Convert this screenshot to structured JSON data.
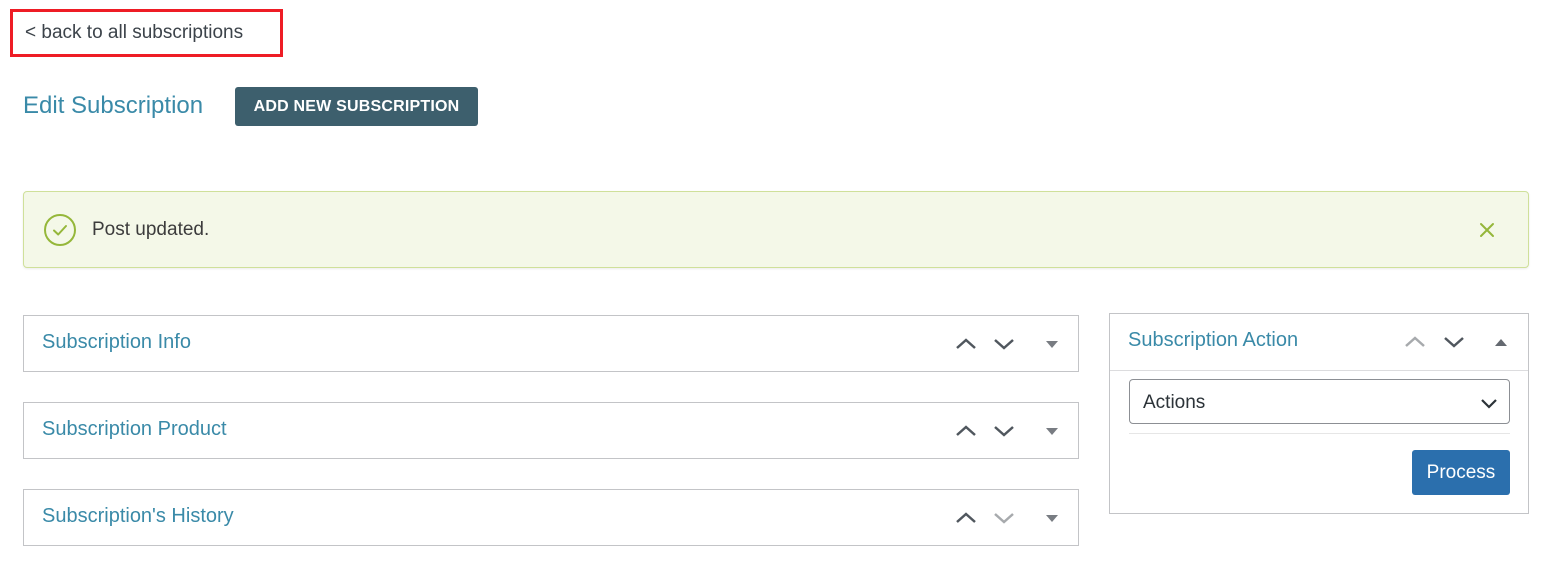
{
  "back_link": {
    "label": "< back to all subscriptions"
  },
  "header": {
    "title": "Edit Subscription",
    "add_new_label": "ADD NEW SUBSCRIPTION"
  },
  "notice": {
    "message": "Post updated.",
    "icon": "check-circle-icon",
    "dismiss_icon": "close-icon",
    "accent_color": "#95b73a"
  },
  "postboxes": [
    {
      "title": "Subscription Info"
    },
    {
      "title": "Subscription Product"
    },
    {
      "title": "Subscription's History"
    }
  ],
  "action_box": {
    "title": "Subscription Action",
    "select": {
      "selected": "Actions"
    },
    "process_label": "Process"
  },
  "colors": {
    "title_blue": "#3a8aa8",
    "add_button": "#3d5f6d",
    "process_button": "#2b6fad",
    "highlight_border": "#ee1c25"
  }
}
